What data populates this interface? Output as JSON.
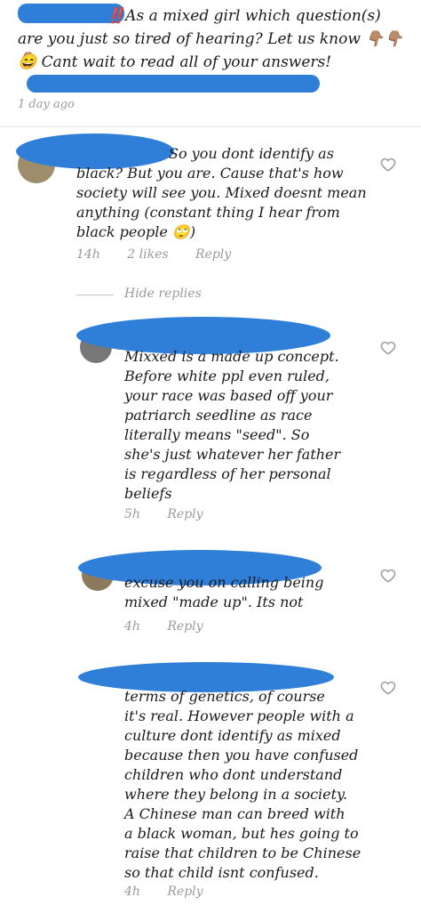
{
  "post": {
    "line1": "‼️As a mixed girl which question(s)",
    "line2": "are you just so tired of hearing? Let us know 👇🏽👇🏽👇🏽",
    "line3": "😄 Cant wait to read all of your answers!",
    "time": "1 day ago"
  },
  "comments": [
    {
      "lines": [
        "So you dont identify as",
        "black? But you are. Cause that's how",
        "society will see you. Mixed doesnt mean",
        "anything (constant thing I hear from",
        "black people 🙄)"
      ],
      "time": "14h",
      "likes": "2 likes",
      "reply": "Reply"
    }
  ],
  "hide_replies": "Hide replies",
  "replies": [
    {
      "lines": [
        "Mixxed is a made up concept.",
        "Before white ppl even ruled,",
        "your race was based off your",
        "patriarch seedline as race",
        "literally means \"seed\". So",
        "she's just whatever her father",
        "is regardless of her personal",
        "beliefs"
      ],
      "time": "5h",
      "reply": "Reply"
    },
    {
      "lines": [
        "excuse you on calling being",
        "mixed \"made up\". Its not"
      ],
      "time": "4h",
      "reply": "Reply"
    },
    {
      "lines": [
        "terms of genetics, of course",
        "it's real. However people with a",
        "culture dont identify as mixed",
        "because then you have confused",
        "children who dont understand",
        "where they belong in a society.",
        "A Chinese man can breed with",
        "a black woman, but hes going to",
        "raise that children to be Chinese",
        "so that child isnt confused."
      ],
      "time": "4h",
      "reply": "Reply"
    }
  ],
  "colors": {
    "redaction": "#2f7fd9",
    "meta": "#9a9a9a"
  },
  "icons": [
    "heart-outline-icon"
  ]
}
